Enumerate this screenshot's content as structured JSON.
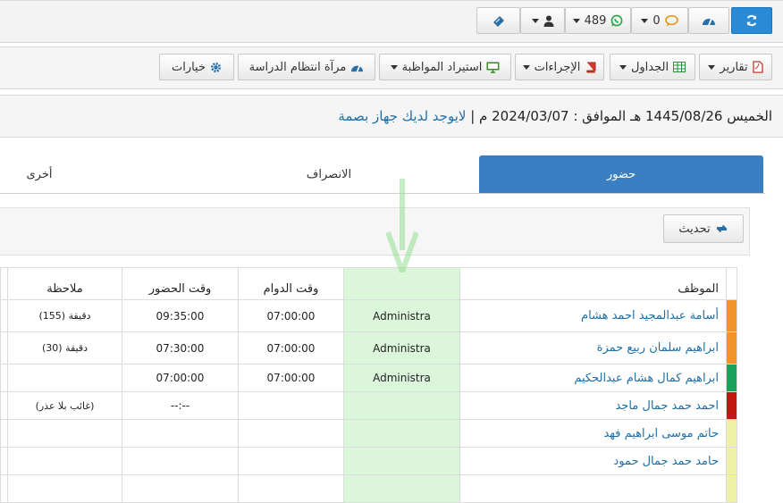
{
  "toolbar1": {
    "count_messages": "0",
    "count_whatsapp": "489"
  },
  "toolbar2": {
    "reports": "تقارير",
    "tables": "الجداول",
    "actions": "الإجراءات",
    "import": "استيراد المواظبة",
    "mirror": "مرآة انتظام الدراسة",
    "options": "خيارات"
  },
  "datebar": {
    "text": "الخميس 1445/08/26 هـ الموافق : 2024/03/07 م |",
    "link": "لايوجد لديك جهاز بصمة"
  },
  "tabs": [
    "حضور",
    "الانصراف",
    "أخرى"
  ],
  "refresh_label": "تحديث",
  "table": {
    "headers": {
      "employee": "الموظف",
      "col2": "",
      "shift_time": "وقت الدوام",
      "attend_time": "وقت الحضور",
      "note": "ملاحظة"
    },
    "rows": [
      {
        "name": "أسامة عبدالمجيد احمد هشام",
        "dept": "Administra",
        "shift": "07:00:00",
        "attend": "09:35:00",
        "note": "(155) دقيقة",
        "color": "#f0932b"
      },
      {
        "name": "ابراهيم سلمان ربيع حمزة",
        "dept": "Administra",
        "shift": "07:00:00",
        "attend": "07:30:00",
        "note": "(30) دقيقة",
        "color": "#f0932b"
      },
      {
        "name": "ابراهيم كمال هشام عبدالحكيم",
        "dept": "Administra",
        "shift": "07:00:00",
        "attend": "07:00:00",
        "note": "",
        "color": "#1aa35a"
      },
      {
        "name": "احمد حمد جمال ماجد",
        "dept": "",
        "shift": "",
        "attend": "--:--",
        "note": "(غائب بلا عذر)",
        "color": "#c0180f"
      },
      {
        "name": "حاتم موسى ابراهيم فهد",
        "dept": "",
        "shift": "",
        "attend": "",
        "note": "",
        "color": "#f1f1a6"
      },
      {
        "name": "حامد حمد جمال حمود",
        "dept": "",
        "shift": "",
        "attend": "",
        "note": "",
        "color": "#f1f1a6"
      },
      {
        "name": "",
        "dept": "",
        "shift": "",
        "attend": "",
        "note": "",
        "color": "#f1f1a6"
      }
    ]
  },
  "colors": {
    "accent": "#2a8ad6",
    "tab_active": "#3a7fc1",
    "link": "#1e6fa8"
  }
}
